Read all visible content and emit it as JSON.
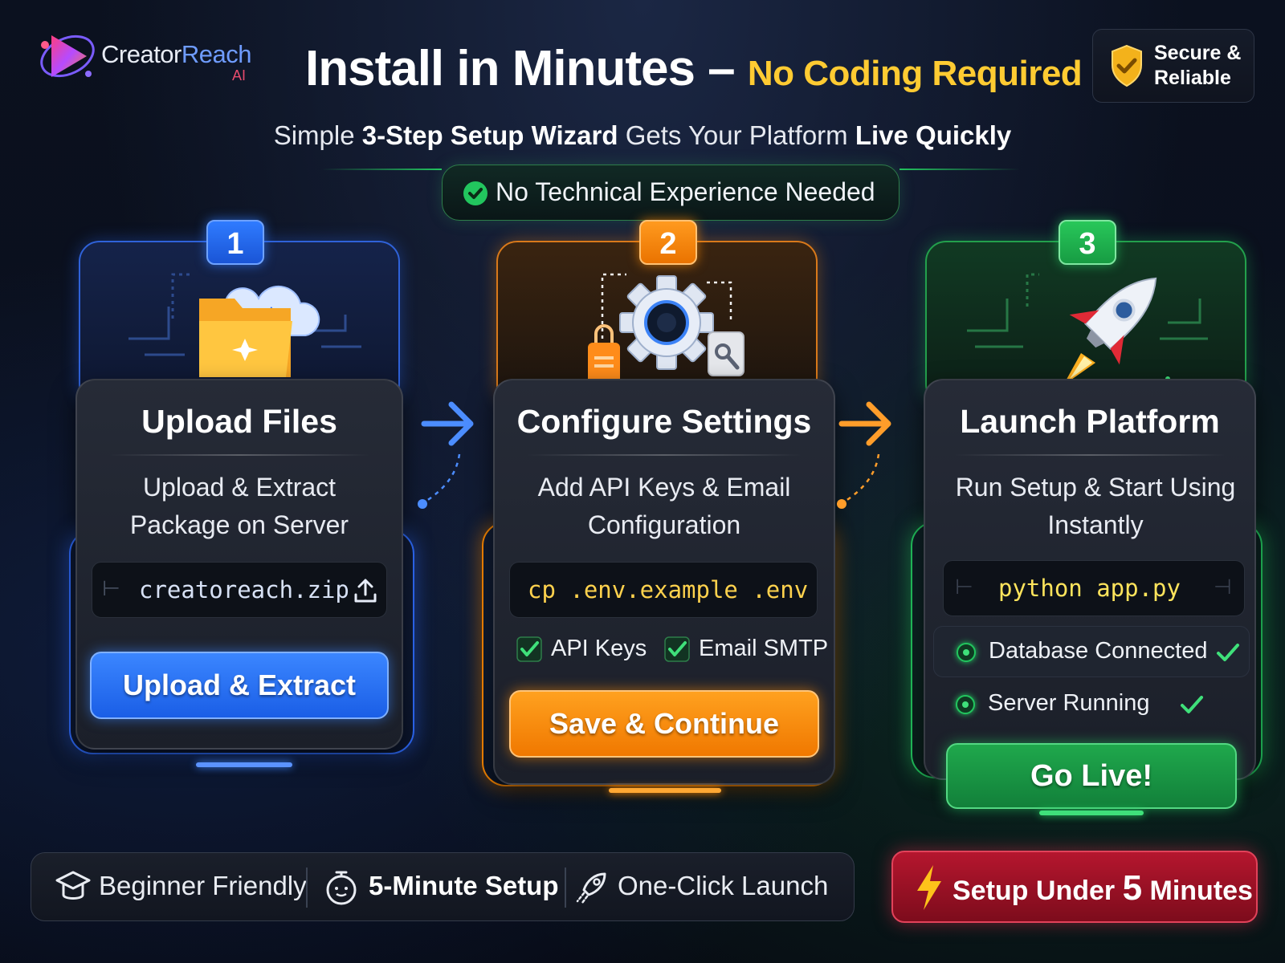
{
  "brand": {
    "name_part1": "Creator",
    "name_part2": "Reach",
    "name_suffix": "AI"
  },
  "header": {
    "title": "Install in Minutes –",
    "title_accent": "No Coding Required",
    "badge_line1": "Secure &",
    "badge_line2": "Reliable",
    "subtitle_pre": "Simple",
    "subtitle_bold1": "3-Step Setup Wizard",
    "subtitle_mid": "Gets Your Platform",
    "subtitle_bold2": "Live Quickly",
    "pill_text": "No Technical Experience Needed"
  },
  "steps": [
    {
      "number": "1",
      "title": "Upload Files",
      "desc_line1": "Upload & Extract",
      "desc_line2": "Package on Server",
      "code": "creatoreach.zip",
      "button": "Upload & Extract",
      "icon": "folder-cloud-icon"
    },
    {
      "number": "2",
      "title": "Configure Settings",
      "desc_line1": "Add API Keys & Email",
      "desc_line2": "Configuration",
      "code": "cp .env.example .env",
      "checks": [
        "API Keys",
        "Email SMTP"
      ],
      "button": "Save & Continue",
      "icon": "gear-icon"
    },
    {
      "number": "3",
      "title": "Launch Platform",
      "desc_line1": "Run Setup & Start Using",
      "desc_line2": "Instantly",
      "code": "python app.py",
      "status": [
        "Database Connected",
        "Server Running"
      ],
      "button": "Go Live!",
      "icon": "rocket-icon"
    }
  ],
  "features": [
    "Beginner Friendly",
    "5-Minute Setup",
    "One-Click Launch"
  ],
  "promo": {
    "pre": "Setup Under",
    "number": "5",
    "post": "Minutes"
  },
  "colors": {
    "blue": "#1f6bff",
    "orange": "#ff8a00",
    "green": "#1fbf4f",
    "yellow": "#ffcb32",
    "red": "#c8172f"
  }
}
